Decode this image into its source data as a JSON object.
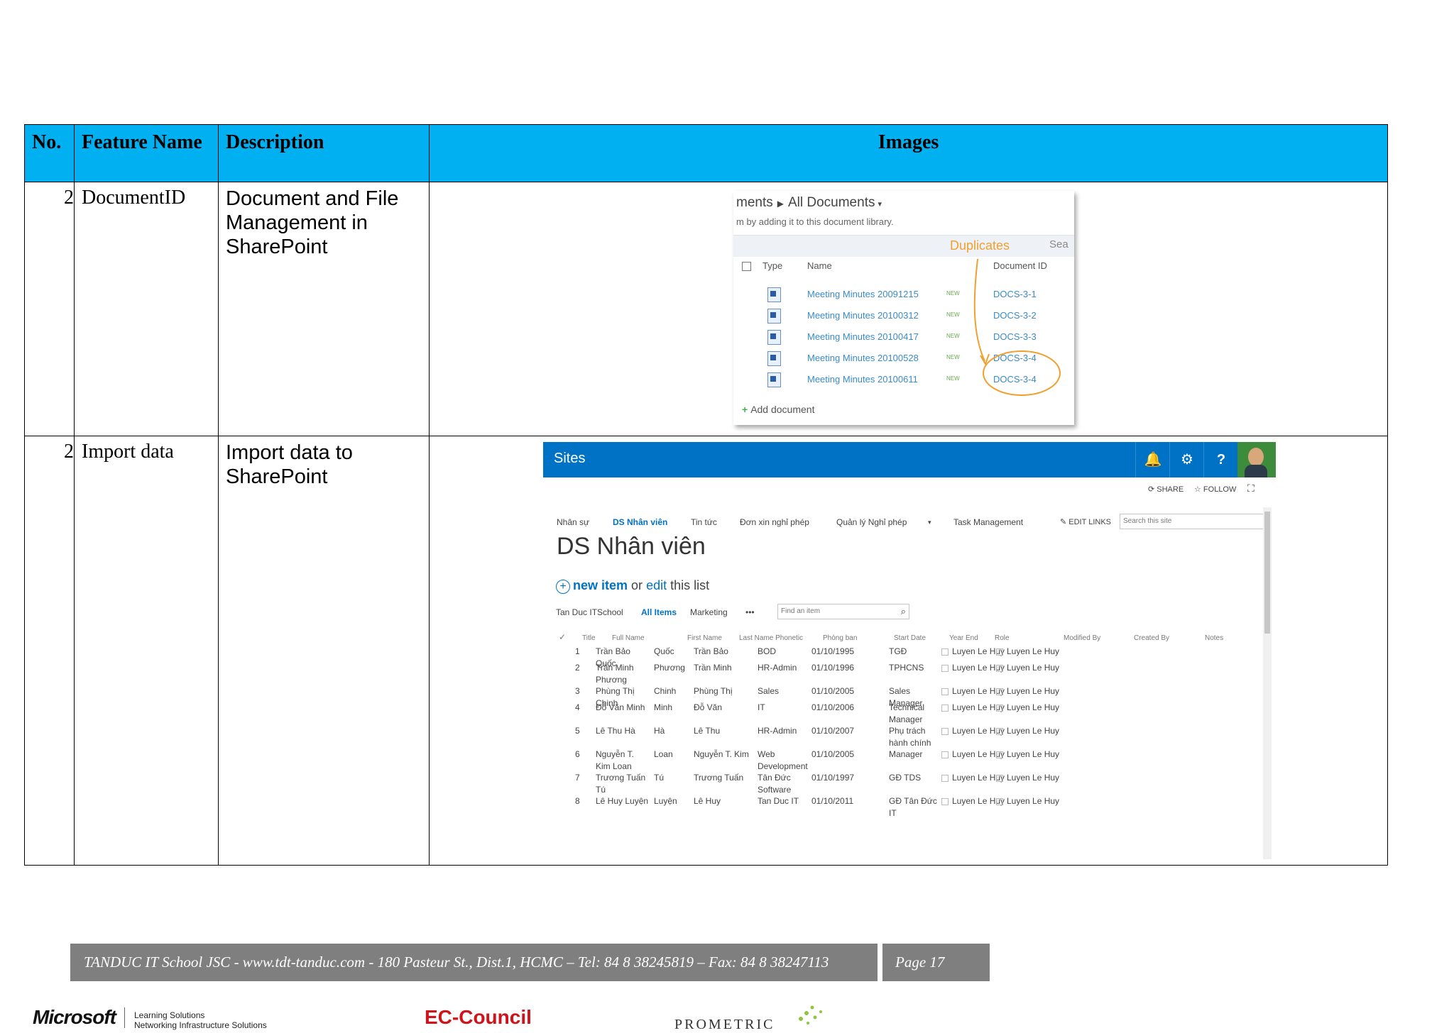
{
  "table": {
    "headers": {
      "no": "No.",
      "feature": "Feature Name",
      "description": "Description",
      "images": "Images"
    },
    "rows": [
      {
        "no": "2",
        "feature": "DocumentID",
        "description": "Document and File Management in SharePoint"
      },
      {
        "no": "2",
        "feature": "Import data",
        "description": "Import data to SharePoint"
      }
    ]
  },
  "shot1": {
    "breadcrumb_start": "ments",
    "breadcrumb_view": "All Documents",
    "hint": "m by adding it to this document library.",
    "duplicates_label": "Duplicates",
    "search_fragment": "Sea",
    "col_type": "Type",
    "col_name": "Name",
    "col_docid": "Document ID",
    "new_badge": "NEW",
    "rows": [
      {
        "name": "Meeting Minutes 20091215",
        "id": "DOCS-3-1"
      },
      {
        "name": "Meeting Minutes 20100312",
        "id": "DOCS-3-2"
      },
      {
        "name": "Meeting Minutes 20100417",
        "id": "DOCS-3-3"
      },
      {
        "name": "Meeting Minutes 20100528",
        "id": "DOCS-3-4"
      },
      {
        "name": "Meeting Minutes 20100611",
        "id": "DOCS-3-4"
      }
    ],
    "add_document": "Add document"
  },
  "shot2": {
    "sites": "Sites",
    "share": "SHARE",
    "follow": "FOLLOW",
    "nav": [
      "Nhân sự",
      "DS Nhân viên",
      "Tin tức",
      "Đơn xin nghỉ phép",
      "Quản lý Nghỉ phép",
      "Task Management"
    ],
    "edit_links": "EDIT LINKS",
    "search_placeholder": "Search this site",
    "title": "DS Nhân viên",
    "new_item": "new item",
    "or": "or",
    "edit": "edit",
    "this_list": "this list",
    "views": [
      "Tan Duc ITSchool",
      "All Items",
      "Marketing"
    ],
    "more": "•••",
    "find_placeholder": "Find an item",
    "columns": [
      "Title",
      "Full Name",
      "First Name",
      "Last Name Phonetic",
      "Phòng ban",
      "Start Date",
      "Year End",
      "Role",
      "Modified By",
      "Created By",
      "Notes"
    ],
    "rows": [
      {
        "title": "1",
        "full": "Trần Bảo Quốc",
        "first": "Quốc",
        "last": "Trần Bảo",
        "dept": "BOD",
        "start": "01/10/1995",
        "role": "TGĐ",
        "mod": "Luyen Le Huy",
        "created": "Luyen Le Huy"
      },
      {
        "title": "2",
        "full": "Trần Minh Phương",
        "first": "Phương",
        "last": "Trần Minh",
        "dept": "HR-Admin",
        "start": "01/10/1996",
        "role": "TPHCNS",
        "mod": "Luyen Le Huy",
        "created": "Luyen Le Huy"
      },
      {
        "title": "3",
        "full": "Phùng Thị Chinh",
        "first": "Chinh",
        "last": "Phùng Thị",
        "dept": "Sales",
        "start": "01/10/2005",
        "role": "Sales Manager",
        "mod": "Luyen Le Huy",
        "created": "Luyen Le Huy"
      },
      {
        "title": "4",
        "full": "Đỗ Văn Minh",
        "first": "Minh",
        "last": "Đỗ Văn",
        "dept": "IT",
        "start": "01/10/2006",
        "role": "Technical Manager",
        "mod": "Luyen Le Huy",
        "created": "Luyen Le Huy"
      },
      {
        "title": "5",
        "full": "Lê Thu Hà",
        "first": "Hà",
        "last": "Lê Thu",
        "dept": "HR-Admin",
        "start": "01/10/2007",
        "role": "Phụ trách hành chính",
        "mod": "Luyen Le Huy",
        "created": "Luyen Le Huy"
      },
      {
        "title": "6",
        "full": "Nguyễn T. Kim Loan",
        "first": "Loan",
        "last": "Nguyễn T. Kim",
        "dept": "Web Development",
        "start": "01/10/2005",
        "role": "Manager",
        "mod": "Luyen Le Huy",
        "created": "Luyen Le Huy"
      },
      {
        "title": "7",
        "full": "Trương Tuấn Tú",
        "first": "Tú",
        "last": "Trương Tuấn",
        "dept": "Tân Đức Software",
        "start": "01/10/1997",
        "role": "GĐ TDS",
        "mod": "Luyen Le Huy",
        "created": "Luyen Le Huy"
      },
      {
        "title": "8",
        "full": "Lê Huy Luyện",
        "first": "Luyện",
        "last": "Lê Huy",
        "dept": "Tan Duc IT",
        "start": "01/10/2011",
        "role": "GĐ Tân Đức IT",
        "mod": "Luyen Le Huy",
        "created": "Luyen Le Huy"
      }
    ]
  },
  "footer": {
    "text": "TANDUC IT School JSC - www.tdt-tanduc.com - 180 Pasteur St., Dist.1, HCMC – Tel: 84 8 38245819 – Fax: 84 8 38247113",
    "page": "Page 17"
  },
  "logos": {
    "microsoft": "Microsoft",
    "microsoft_line1": "Learning Solutions",
    "microsoft_line2": "Networking Infrastructure Solutions",
    "eccouncil": "EC-Council",
    "prometric": "PROMETRIC"
  }
}
